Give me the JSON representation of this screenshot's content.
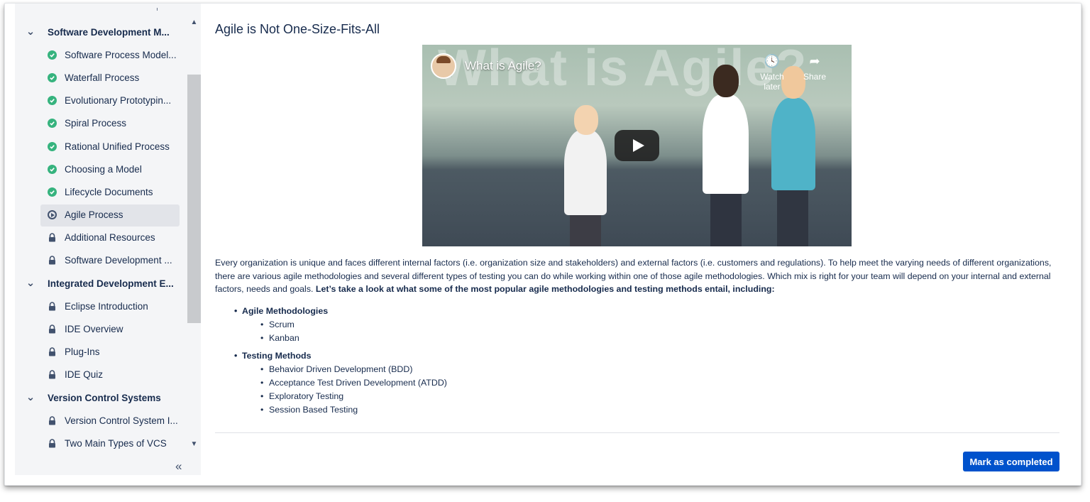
{
  "sidebar": {
    "items": [
      {
        "type": "section",
        "label": "Software Development M...",
        "icon": "chevron-down-icon"
      },
      {
        "type": "lesson",
        "label": "Software Process Model...",
        "icon": "check-circle-icon"
      },
      {
        "type": "lesson",
        "label": "Waterfall Process",
        "icon": "check-circle-icon"
      },
      {
        "type": "lesson",
        "label": "Evolutionary Prototypin...",
        "icon": "check-circle-icon"
      },
      {
        "type": "lesson",
        "label": "Spiral Process",
        "icon": "check-circle-icon"
      },
      {
        "type": "lesson",
        "label": "Rational Unified Process",
        "icon": "check-circle-icon"
      },
      {
        "type": "lesson",
        "label": "Choosing a Model",
        "icon": "check-circle-icon"
      },
      {
        "type": "lesson",
        "label": "Lifecycle Documents",
        "icon": "check-circle-icon"
      },
      {
        "type": "lesson",
        "label": "Agile Process",
        "icon": "play-circle-icon",
        "active": true
      },
      {
        "type": "lesson",
        "label": "Additional Resources",
        "icon": "lock-icon"
      },
      {
        "type": "lesson",
        "label": "Software Development ...",
        "icon": "lock-icon"
      },
      {
        "type": "section",
        "label": "Integrated Development E...",
        "icon": "chevron-down-icon"
      },
      {
        "type": "lesson",
        "label": "Eclipse Introduction",
        "icon": "lock-icon"
      },
      {
        "type": "lesson",
        "label": "IDE Overview",
        "icon": "lock-icon"
      },
      {
        "type": "lesson",
        "label": "Plug-Ins",
        "icon": "lock-icon"
      },
      {
        "type": "lesson",
        "label": "IDE Quiz",
        "icon": "lock-icon"
      },
      {
        "type": "section",
        "label": "Version Control Systems",
        "icon": "chevron-down-icon"
      },
      {
        "type": "lesson",
        "label": "Version Control System I...",
        "icon": "lock-icon"
      },
      {
        "type": "lesson",
        "label": "Two Main Types of VCS",
        "icon": "lock-icon"
      }
    ],
    "collapse_glyph": "«"
  },
  "main": {
    "title": "Agile is Not One-Size-Fits-All",
    "video": {
      "title": "What is Agile?",
      "watch_later": "Watch later",
      "share": "Share",
      "thumbnail_text": "What is Agile?"
    },
    "paragraph": "Every organization is unique and faces different internal factors (i.e. organization size and stakeholders) and external factors (i.e. customers and regulations). To help meet the varying needs of different organizations, there are various agile methodologies and several different types of testing you can do while working within one of those agile methodologies. Which mix is right for your team will depend on your internal and external factors, needs and goals. ",
    "paragraph_bold": "Let’s take a look at what some of the most popular agile methodologies and testing methods entail, including:",
    "lists": [
      {
        "heading": "Agile Methodologies",
        "items": [
          "Scrum",
          "Kanban"
        ]
      },
      {
        "heading": "Testing Methods",
        "items": [
          "Behavior Driven Development (BDD)",
          "Acceptance Test Driven Development (ATDD)",
          "Exploratory Testing",
          "Session Based Testing"
        ]
      }
    ],
    "complete_button": "Mark as completed"
  },
  "colors": {
    "accent": "#0052cc",
    "check": "#36b37e",
    "text": "#172b4d",
    "sidebar_bg": "#f4f5f7"
  }
}
